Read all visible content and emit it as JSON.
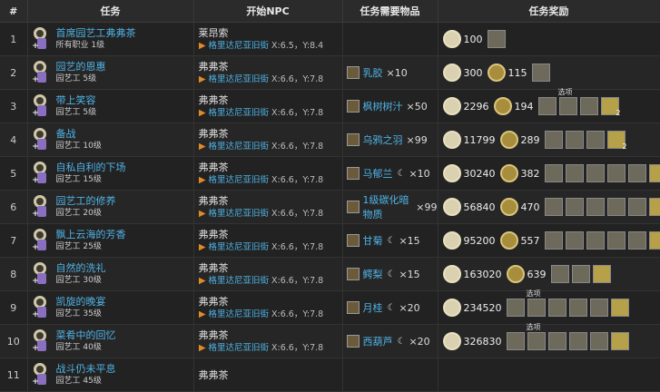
{
  "headers": [
    "#",
    "任务",
    "开始NPC",
    "任务需要物品",
    "任务奖励"
  ],
  "option_label": "选项",
  "rows": [
    {
      "no": "1",
      "name": "首席园艺工弗弗茶",
      "sub": "所有职业 1级",
      "npc": "莱昂索",
      "place": "格里达尼亚旧街",
      "coord": "X:6.5，Y:8.4",
      "item": "",
      "qty": "",
      "hq": false,
      "xp": "100",
      "gil": "",
      "rewards": [
        "g"
      ],
      "options": false
    },
    {
      "no": "2",
      "name": "园艺的恩惠",
      "sub": "园艺工 5级",
      "npc": "弗弗茶",
      "place": "格里达尼亚旧街",
      "coord": "X:6.6，Y:7.8",
      "item": "乳胶",
      "qty": "×10",
      "hq": false,
      "xp": "300",
      "gil": "115",
      "rewards": [
        "g"
      ],
      "options": false
    },
    {
      "no": "3",
      "name": "带上笑容",
      "sub": "园艺工 5级",
      "npc": "弗弗茶",
      "place": "格里达尼亚旧街",
      "coord": "X:6.6，Y:7.8",
      "item": "枫树树汁",
      "qty": "×50",
      "hq": false,
      "xp": "2296",
      "gil": "194",
      "rewards": [
        "g",
        "g",
        "g",
        "y"
      ],
      "options": true,
      "badge": "2"
    },
    {
      "no": "4",
      "name": "备战",
      "sub": "园艺工 10级",
      "npc": "弗弗茶",
      "place": "格里达尼亚旧街",
      "coord": "X:6.6，Y:7.8",
      "item": "乌鸦之羽",
      "qty": "×99",
      "hq": false,
      "xp": "11799",
      "gil": "289",
      "rewards": [
        "g",
        "g",
        "g",
        "y"
      ],
      "options": false,
      "badge": "2"
    },
    {
      "no": "5",
      "name": "自私自利的下场",
      "sub": "园艺工 15级",
      "npc": "弗弗茶",
      "place": "格里达尼亚旧街",
      "coord": "X:6.6，Y:7.8",
      "item": "马郁兰",
      "qty": "×10",
      "hq": true,
      "xp": "30240",
      "gil": "382",
      "rewards": [
        "g",
        "g",
        "g",
        "g",
        "g",
        "y"
      ],
      "options": false
    },
    {
      "no": "6",
      "name": "园艺工的修养",
      "sub": "园艺工 20级",
      "npc": "弗弗茶",
      "place": "格里达尼亚旧街",
      "coord": "X:6.6，Y:7.8",
      "item": "1级碳化暗物质",
      "qty": "×99",
      "hq": false,
      "xp": "56840",
      "gil": "470",
      "rewards": [
        "g",
        "g",
        "g",
        "g",
        "g",
        "y"
      ],
      "options": false
    },
    {
      "no": "7",
      "name": "飘上云海的芳香",
      "sub": "园艺工 25级",
      "npc": "弗弗茶",
      "place": "格里达尼亚旧街",
      "coord": "X:6.6，Y:7.8",
      "item": "甘菊",
      "qty": "×15",
      "hq": true,
      "xp": "95200",
      "gil": "557",
      "rewards": [
        "g",
        "g",
        "g",
        "g",
        "g",
        "y"
      ],
      "options": false
    },
    {
      "no": "8",
      "name": "自然的洗礼",
      "sub": "园艺工 30级",
      "npc": "弗弗茶",
      "place": "格里达尼亚旧街",
      "coord": "X:6.6，Y:7.8",
      "item": "鳄梨",
      "qty": "×15",
      "hq": true,
      "xp": "163020",
      "gil": "639",
      "rewards": [
        "g",
        "g",
        "y"
      ],
      "options": false
    },
    {
      "no": "9",
      "name": "凯旋的晚宴",
      "sub": "园艺工 35级",
      "npc": "弗弗茶",
      "place": "格里达尼亚旧街",
      "coord": "X:6.6，Y:7.8",
      "item": "月桂",
      "qty": "×20",
      "hq": true,
      "xp": "234520",
      "gil": "",
      "rewards": [
        "g",
        "g",
        "g",
        "g",
        "g",
        "y"
      ],
      "options": true
    },
    {
      "no": "10",
      "name": "菜肴中的回忆",
      "sub": "园艺工 40级",
      "npc": "弗弗茶",
      "place": "格里达尼亚旧街",
      "coord": "X:6.6，Y:7.8",
      "item": "西葫芦",
      "qty": "×20",
      "hq": true,
      "xp": "326830",
      "gil": "",
      "rewards": [
        "g",
        "g",
        "g",
        "g",
        "g",
        "y"
      ],
      "options": true
    },
    {
      "no": "11",
      "name": "战斗仍未平息",
      "sub": "园艺工 45级",
      "npc": "弗弗茶",
      "place": "",
      "coord": "",
      "item": "",
      "qty": "",
      "hq": false,
      "xp": "",
      "gil": "",
      "rewards": [],
      "options": true
    }
  ]
}
